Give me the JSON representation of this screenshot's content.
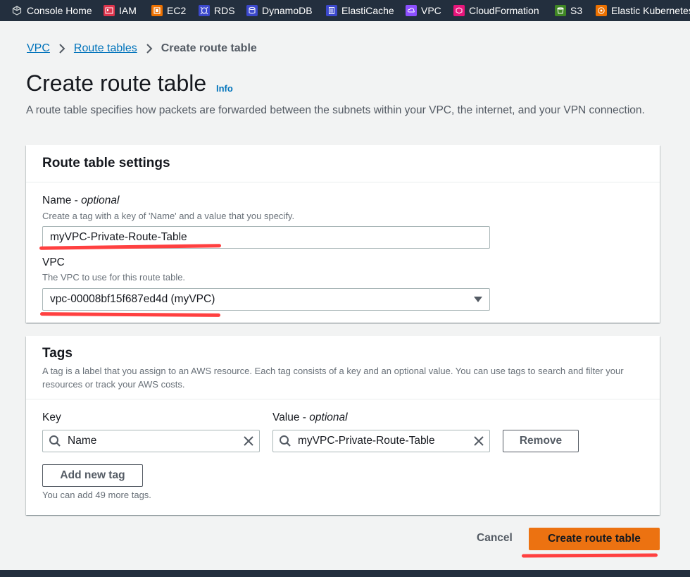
{
  "favorites": [
    {
      "label": "Console Home",
      "icon": "cube-icon",
      "color": "#545b64"
    },
    {
      "label": "IAM",
      "icon": "iam-icon",
      "color": "#dd344c"
    },
    {
      "label": "EC2",
      "icon": "ec2-icon",
      "color": "#ed7100"
    },
    {
      "label": "RDS",
      "icon": "rds-icon",
      "color": "#3b48cc"
    },
    {
      "label": "DynamoDB",
      "icon": "dynamodb-icon",
      "color": "#3b48cc"
    },
    {
      "label": "ElastiCache",
      "icon": "elasticache-icon",
      "color": "#3b48cc"
    },
    {
      "label": "VPC",
      "icon": "vpc-icon",
      "color": "#8c4fff"
    },
    {
      "label": "CloudFormation",
      "icon": "cloudformation-icon",
      "color": "#e7157b"
    },
    {
      "label": "S3",
      "icon": "s3-icon",
      "color": "#3f8624"
    },
    {
      "label": "Elastic Kubernetes",
      "icon": "eks-icon",
      "color": "#ed7100"
    }
  ],
  "breadcrumb": {
    "vpc": "VPC",
    "route_tables": "Route tables",
    "current": "Create route table"
  },
  "header": {
    "title": "Create route table",
    "info": "Info",
    "description": "A route table specifies how packets are forwarded between the subnets within your VPC, the internet, and your VPN connection."
  },
  "settings": {
    "title": "Route table settings",
    "name_label": "Name",
    "name_optional": "optional",
    "name_hint": "Create a tag with a key of 'Name' and a value that you specify.",
    "name_value": "myVPC-Private-Route-Table",
    "vpc_label": "VPC",
    "vpc_hint": "The VPC to use for this route table.",
    "vpc_value": "vpc-00008bf15f687ed4d (myVPC)"
  },
  "tags": {
    "title": "Tags",
    "description": "A tag is a label that you assign to an AWS resource. Each tag consists of a key and an optional value. You can use tags to search and filter your resources or track your AWS costs.",
    "key_label": "Key",
    "value_label": "Value",
    "value_optional": "optional",
    "key_value": "Name",
    "value_value": "myVPC-Private-Route-Table",
    "remove_label": "Remove",
    "add_label": "Add new tag",
    "remaining": "You can add 49 more tags."
  },
  "footer": {
    "cancel": "Cancel",
    "create": "Create route table"
  },
  "colors": {
    "accent": "#0073bb",
    "primary_button": "#ec7211",
    "annotation": "#ff4040",
    "topbar": "#232f3e"
  }
}
